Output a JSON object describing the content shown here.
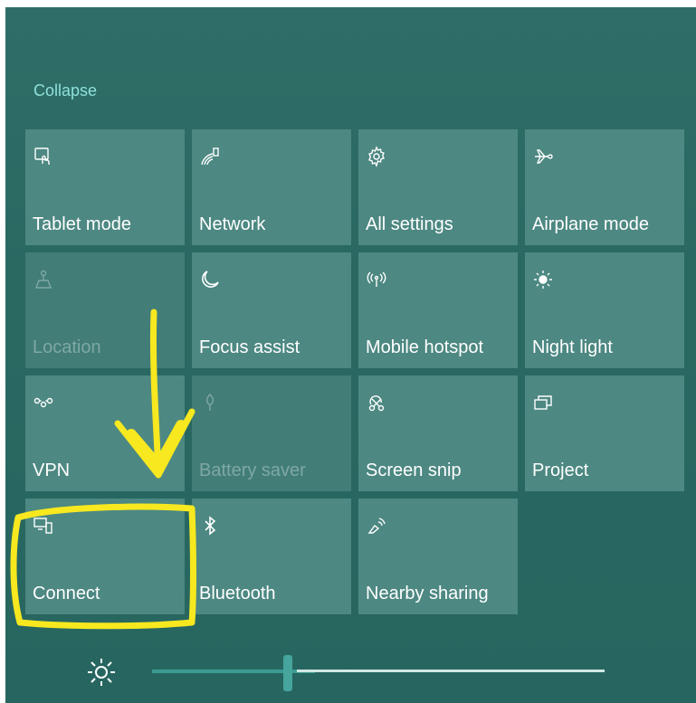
{
  "header": {
    "collapse_label": "Collapse"
  },
  "tiles": [
    {
      "label": "Tablet mode",
      "icon": "tablet-mode-icon",
      "state": "on"
    },
    {
      "label": "Network",
      "icon": "network-icon",
      "state": "on"
    },
    {
      "label": "All settings",
      "icon": "gear-icon",
      "state": "on"
    },
    {
      "label": "Airplane mode",
      "icon": "airplane-icon",
      "state": "on"
    },
    {
      "label": "Location",
      "icon": "location-icon",
      "state": "disabled"
    },
    {
      "label": "Focus assist",
      "icon": "moon-icon",
      "state": "on"
    },
    {
      "label": "Mobile hotspot",
      "icon": "hotspot-icon",
      "state": "on"
    },
    {
      "label": "Night light",
      "icon": "sun-icon",
      "state": "on"
    },
    {
      "label": "VPN",
      "icon": "vpn-icon",
      "state": "on"
    },
    {
      "label": "Battery saver",
      "icon": "battery-saver-icon",
      "state": "disabled"
    },
    {
      "label": "Screen snip",
      "icon": "screen-snip-icon",
      "state": "on"
    },
    {
      "label": "Project",
      "icon": "project-icon",
      "state": "on"
    },
    {
      "label": "Connect",
      "icon": "connect-icon",
      "state": "on"
    },
    {
      "label": "Bluetooth",
      "icon": "bluetooth-icon",
      "state": "on"
    },
    {
      "label": "Nearby sharing",
      "icon": "nearby-sharing-icon",
      "state": "on"
    }
  ],
  "brightness": {
    "icon": "brightness-icon",
    "level_fraction": 0.3
  },
  "colors": {
    "panel": "#2a6862",
    "tile": "#4d8882",
    "accent_text": "#8fe0db",
    "annotation": "#f7e81f"
  }
}
